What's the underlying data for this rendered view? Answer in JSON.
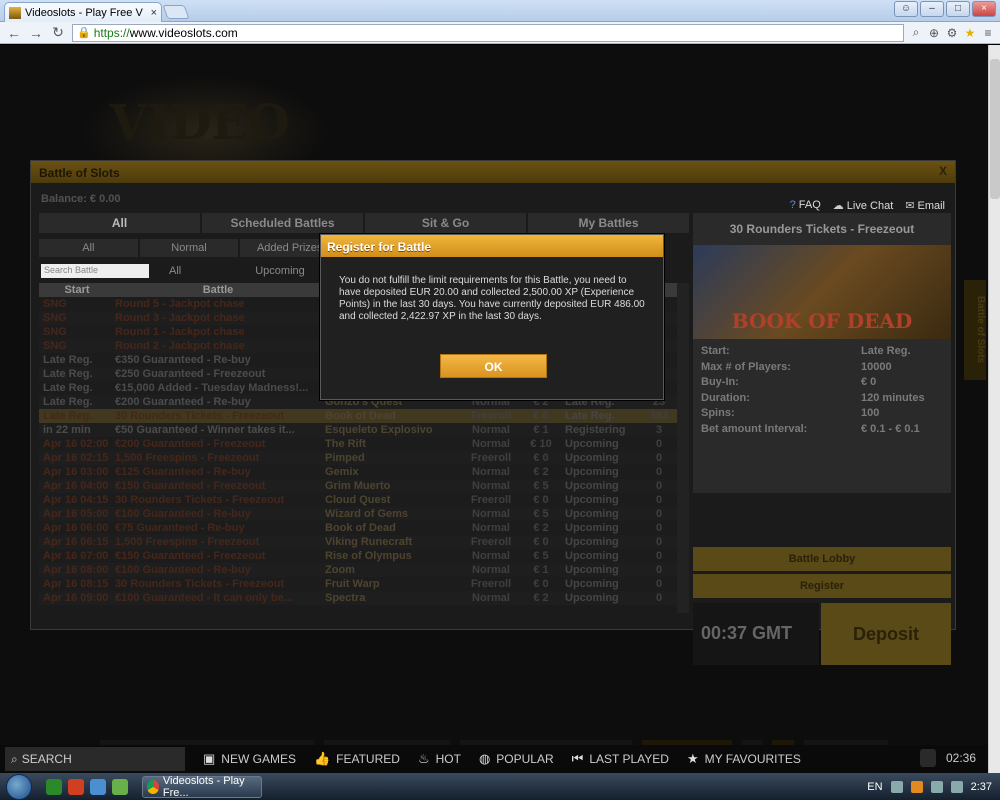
{
  "browser": {
    "tab_title": "Videoslots - Play Free V",
    "tab_close": "×",
    "url_scheme": "https://",
    "url_rest": "www.videoslots.com",
    "window_buttons": [
      "person-icon",
      "minimize-icon",
      "maximize-icon",
      "close-icon"
    ]
  },
  "battle": {
    "title": "Battle of Slots",
    "close": "X",
    "balance": "Balance: € 0.00",
    "help": [
      {
        "icon": "question-icon",
        "label": "FAQ"
      },
      {
        "icon": "chat-icon",
        "label": "Live Chat"
      },
      {
        "icon": "mail-icon",
        "label": "Email"
      }
    ],
    "tabs": [
      "All",
      "Scheduled Battles",
      "Sit & Go",
      "My Battles"
    ],
    "filters": [
      "All",
      "Normal",
      "Added Prizes"
    ],
    "search_placeholder": "Search Battle",
    "search_filters": [
      "All",
      "Upcoming"
    ],
    "columns": {
      "start": "Start",
      "battle": "Battle"
    },
    "rows": [
      {
        "start": "SNG",
        "battle": "Round 5 - Jackpot chase",
        "game": "",
        "type": "",
        "bet": "",
        "status": "",
        "players": "",
        "cls": ""
      },
      {
        "start": "SNG",
        "battle": "Round 3 - Jackpot chase",
        "game": "",
        "type": "",
        "bet": "",
        "status": "",
        "players": "",
        "cls": ""
      },
      {
        "start": "SNG",
        "battle": "Round 1 - Jackpot chase",
        "game": "",
        "type": "",
        "bet": "",
        "status": "",
        "players": "",
        "cls": ""
      },
      {
        "start": "SNG",
        "battle": "Round 2 - Jackpot chase",
        "game": "",
        "type": "",
        "bet": "",
        "status": "",
        "players": "",
        "cls": ""
      },
      {
        "start": "Late Reg.",
        "battle": "€350 Guaranteed - Re-buy",
        "game": "",
        "type": "",
        "bet": "",
        "status": "",
        "players": "",
        "cls": "wh"
      },
      {
        "start": "Late Reg.",
        "battle": "€250 Guaranteed - Freezeout",
        "game": "",
        "type": "",
        "bet": "",
        "status": "",
        "players": "",
        "cls": "wh"
      },
      {
        "start": "Late Reg.",
        "battle": "€15,000 Added - Tuesday Madness!...",
        "game": "",
        "type": "",
        "bet": "",
        "status": "",
        "players": "",
        "cls": "wh"
      },
      {
        "start": "Late Reg.",
        "battle": "€200 Guaranteed - Re-buy",
        "game": "Gonzo's Quest",
        "type": "Normal",
        "bet": "€ 2",
        "status": "Late Reg.",
        "players": "23",
        "cls": "wh"
      },
      {
        "start": "Late Reg.",
        "battle": "30 Rounders Tickets - Freezeout",
        "game": "Book of Dead",
        "type": "Freeroll",
        "bet": "€ 0",
        "status": "Late Reg.",
        "players": "383",
        "cls": "hl"
      },
      {
        "start": "in 22 min",
        "battle": "€50 Guaranteed - Winner takes it...",
        "game": "Esqueleto Explosivo",
        "type": "Normal",
        "bet": "€ 1",
        "status": "Registering",
        "players": "3",
        "cls": "wh"
      },
      {
        "start": "Apr 16 02:00",
        "battle": "€200 Guaranteed - Freezeout",
        "game": "The Rift",
        "type": "Normal",
        "bet": "€ 10",
        "status": "Upcoming",
        "players": "0",
        "cls": ""
      },
      {
        "start": "Apr 16 02:15",
        "battle": "1,500 Freespins - Freezeout",
        "game": "Pimped",
        "type": "Freeroll",
        "bet": "€ 0",
        "status": "Upcoming",
        "players": "0",
        "cls": ""
      },
      {
        "start": "Apr 16 03:00",
        "battle": "€125 Guaranteed - Re-buy",
        "game": "Gemix",
        "type": "Normal",
        "bet": "€ 2",
        "status": "Upcoming",
        "players": "0",
        "cls": ""
      },
      {
        "start": "Apr 16 04:00",
        "battle": "€150 Guaranteed - Freezeout",
        "game": "Grim Muerto",
        "type": "Normal",
        "bet": "€ 5",
        "status": "Upcoming",
        "players": "0",
        "cls": ""
      },
      {
        "start": "Apr 16 04:15",
        "battle": "30 Rounders Tickets - Freezeout",
        "game": "Cloud Quest",
        "type": "Freeroll",
        "bet": "€ 0",
        "status": "Upcoming",
        "players": "0",
        "cls": ""
      },
      {
        "start": "Apr 16 05:00",
        "battle": "€100 Guaranteed - Re-buy",
        "game": "Wizard of Gems",
        "type": "Normal",
        "bet": "€ 5",
        "status": "Upcoming",
        "players": "0",
        "cls": ""
      },
      {
        "start": "Apr 16 06:00",
        "battle": "€75 Guaranteed - Re-buy",
        "game": "Book of Dead",
        "type": "Normal",
        "bet": "€ 2",
        "status": "Upcoming",
        "players": "0",
        "cls": ""
      },
      {
        "start": "Apr 16 06:15",
        "battle": "1,500 Freespins - Freezeout",
        "game": "Viking Runecraft",
        "type": "Freeroll",
        "bet": "€ 0",
        "status": "Upcoming",
        "players": "0",
        "cls": ""
      },
      {
        "start": "Apr 16 07:00",
        "battle": "€150 Guaranteed - Freezeout",
        "game": "Rise of Olympus",
        "type": "Normal",
        "bet": "€ 5",
        "status": "Upcoming",
        "players": "0",
        "cls": ""
      },
      {
        "start": "Apr 16 08:00",
        "battle": "€100 Guaranteed - Re-buy",
        "game": "Zoom",
        "type": "Normal",
        "bet": "€ 1",
        "status": "Upcoming",
        "players": "0",
        "cls": ""
      },
      {
        "start": "Apr 16 08:15",
        "battle": "30 Rounders Tickets - Freezeout",
        "game": "Fruit Warp",
        "type": "Freeroll",
        "bet": "€ 0",
        "status": "Upcoming",
        "players": "0",
        "cls": ""
      },
      {
        "start": "Apr 16 09:00",
        "battle": "€100 Guaranteed - It can only be...",
        "game": "Spectra",
        "type": "Normal",
        "bet": "€ 2",
        "status": "Upcoming",
        "players": "0",
        "cls": ""
      }
    ],
    "side": {
      "title": "30 Rounders Tickets - Freezeout",
      "game_image_text": "BOOK OF DEAD",
      "info": [
        {
          "k": "Start:",
          "v": "Late Reg."
        },
        {
          "k": "Max # of Players:",
          "v": "10000"
        },
        {
          "k": "Buy-In:",
          "v": "€ 0"
        },
        {
          "k": "Duration:",
          "v": "120 minutes"
        },
        {
          "k": "Spins:",
          "v": "100"
        },
        {
          "k": "Bet amount Interval:",
          "v": "€ 0.1 - € 0.1"
        }
      ],
      "lobby_button": "Battle Lobby",
      "register_button": "Register",
      "clock": "00:37  GMT",
      "deposit_button": "Deposit"
    },
    "side_tab": "Battle of Slots"
  },
  "dialog": {
    "title": "Register for Battle",
    "message": "You do not fulfill the limit requirements for this Battle, you need to have deposited EUR 20.00 and collected 2,500.00 XP (Experience Points) in the last 30 days. You have currently deposited EUR 486.00 and collected 2,422.97 XP in the last 30 days.",
    "ok": "OK"
  },
  "bottom_nav": {
    "search": "SEARCH",
    "items": [
      {
        "icon": "new-games-icon",
        "label": "NEW GAMES"
      },
      {
        "icon": "thumbs-up-icon",
        "label": "FEATURED"
      },
      {
        "icon": "flame-icon",
        "label": "HOT"
      },
      {
        "icon": "chat-bubble-icon",
        "label": "POPULAR"
      },
      {
        "icon": "rewind-icon",
        "label": "LAST PLAYED"
      },
      {
        "icon": "star-icon",
        "label": "MY FAVOURITES"
      }
    ],
    "clock": "02:36"
  },
  "taskbar": {
    "task_label": "Videoslots - Play Fre...",
    "lang": "EN",
    "time": "2:37"
  },
  "colors": {
    "accent": "#E8A530",
    "highlight_row": "#7D6A28"
  }
}
